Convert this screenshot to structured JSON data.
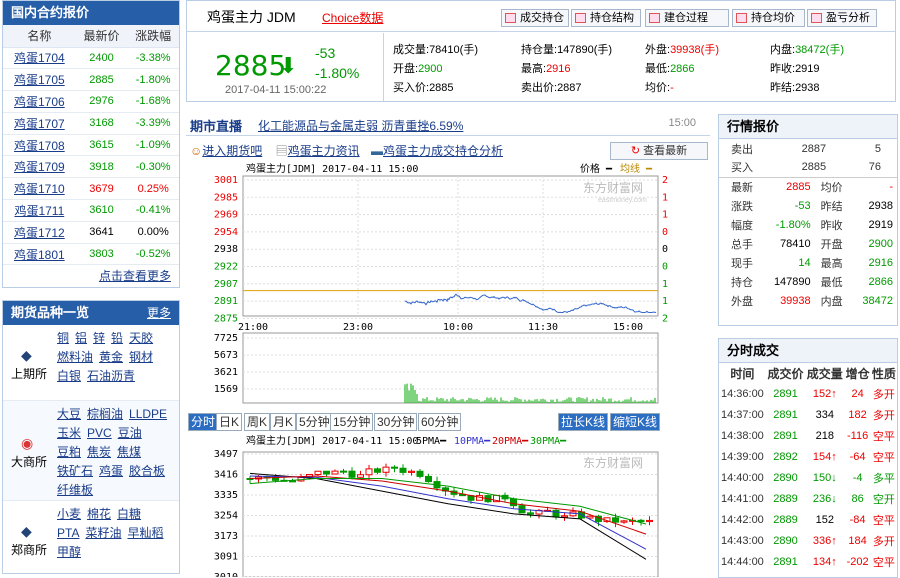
{
  "contracts": {
    "title": "国内合约报价",
    "headers": [
      "名称",
      "最新价",
      "涨跌幅"
    ],
    "rows": [
      [
        "鸡蛋1704",
        "2400",
        "-3.38%",
        "g"
      ],
      [
        "鸡蛋1705",
        "2885",
        "-1.80%",
        "g"
      ],
      [
        "鸡蛋1706",
        "2976",
        "-1.68%",
        "g"
      ],
      [
        "鸡蛋1707",
        "3168",
        "-3.39%",
        "g"
      ],
      [
        "鸡蛋1708",
        "3615",
        "-1.09%",
        "g"
      ],
      [
        "鸡蛋1709",
        "3918",
        "-0.30%",
        "g"
      ],
      [
        "鸡蛋1710",
        "3679",
        "0.25%",
        "r"
      ],
      [
        "鸡蛋1711",
        "3610",
        "-0.41%",
        "g"
      ],
      [
        "鸡蛋1712",
        "3641",
        "0.00%",
        "k"
      ],
      [
        "鸡蛋1801",
        "3803",
        "-0.52%",
        "g"
      ]
    ],
    "more": "点击查看更多"
  },
  "varieties": {
    "title": "期货品种一览",
    "more": "更多",
    "groups": [
      {
        "name": "上期所",
        "items": [
          "铜",
          "铝",
          "锌",
          "铅",
          "天胶",
          "燃料油",
          "黄金",
          "钢材",
          "白银",
          "石油沥青"
        ]
      },
      {
        "name": "大商所",
        "items": [
          "大豆",
          "棕榈油",
          "LLDPE",
          "玉米",
          "PVC",
          "豆油",
          "豆粕",
          "焦炭",
          "焦煤",
          "铁矿石",
          "鸡蛋",
          "胶合板",
          "纤维板"
        ]
      },
      {
        "name": "郑商所",
        "items": [
          "小麦",
          "棉花",
          "白糖",
          "PTA",
          "菜籽油",
          "早籼稻",
          "甲醇"
        ]
      }
    ]
  },
  "header": {
    "name": "鸡蛋主力 JDM",
    "choice": "Choice数据",
    "price": "2885",
    "change": "-53",
    "pct": "-1.80%",
    "time": "2017-04-11 15:00:22",
    "buttons": [
      "成交持仓",
      "持仓结构",
      "建仓过程",
      "持仓均价",
      "盈亏分析"
    ],
    "stats": [
      [
        "成交量:",
        "78410(手)",
        "k"
      ],
      [
        "持仓量:",
        "147890(手)",
        "k"
      ],
      [
        "外盘:",
        "39938(手)",
        "r"
      ],
      [
        "内盘:",
        "38472(手)",
        "g"
      ],
      [
        "开盘:",
        "2900",
        "g"
      ],
      [
        "最高:",
        "2916",
        "r"
      ],
      [
        "最低:",
        "2866",
        "g"
      ],
      [
        "昨收:",
        "2919",
        "k"
      ],
      [
        "买入价:",
        "2885",
        "k"
      ],
      [
        "卖出价:",
        "2887",
        "k"
      ],
      [
        "均价:",
        "-",
        "r"
      ],
      [
        "昨结:",
        "2938",
        "k"
      ]
    ]
  },
  "news": {
    "label": "期市直播",
    "headline": "化工能源品与金属走弱 沥青重挫6.59%",
    "time": "15:00"
  },
  "links": [
    "进入期货吧",
    "鸡蛋主力资讯",
    "鸡蛋主力成交持仓分析"
  ],
  "refresh": "查看最新",
  "intraday": {
    "title": "鸡蛋主力[JDM] 2017-04-11 15:00",
    "legend_price": "价格",
    "legend_avg": "均线",
    "watermark": "东方财富网",
    "watermark_sub": "eastmoney.com",
    "left_ticks": [
      "3001",
      "2985",
      "2969",
      "2954",
      "2938",
      "2922",
      "2907",
      "2891",
      "2875"
    ],
    "right_ticks": [
      "2.14%",
      "1.61%",
      "1.07%",
      "0.54%",
      "0.00%",
      "0.54%",
      "1.07%",
      "1.61%",
      "2.14%"
    ],
    "x_ticks": [
      "21:00",
      "23:00",
      "10:00",
      "11:30",
      "15:00"
    ],
    "vol_ticks": [
      "7725",
      "5673",
      "3621",
      "1569"
    ]
  },
  "chart_data": [
    {
      "type": "line",
      "title": "鸡蛋主力[JDM] 2017-04-11 15:00",
      "x": [
        "21:00",
        "23:00",
        "10:00",
        "11:30",
        "15:00"
      ],
      "ylim": [
        2875,
        3001
      ],
      "series": [
        {
          "name": "价格",
          "values": [
            2895,
            2885,
            2906,
            2893,
            2885
          ]
        },
        {
          "name": "均线",
          "values": [
            2900,
            2900,
            2900,
            2900,
            2900
          ]
        }
      ]
    },
    {
      "type": "bar",
      "title": "",
      "categories": [
        "21:00",
        "23:00",
        "10:00",
        "11:30",
        "15:00"
      ],
      "values": [
        0,
        0,
        7725,
        600,
        1200
      ],
      "ylim": [
        0,
        7725
      ]
    },
    {
      "type": "line",
      "title": "鸡蛋主力[JDM] 2017-04-11 15:00",
      "ylim": [
        3010,
        3497
      ],
      "series": [
        {
          "name": "5PMA",
          "values": [
            3420,
            3400,
            3350,
            3300,
            3260,
            3240,
            3080
          ]
        },
        {
          "name": "10PMA",
          "values": [
            3410,
            3405,
            3370,
            3320,
            3280,
            3260,
            3120
          ]
        },
        {
          "name": "20PMA",
          "values": [
            3400,
            3410,
            3390,
            3350,
            3300,
            3270,
            3180
          ]
        },
        {
          "name": "30PMA",
          "values": [
            3380,
            3400,
            3400,
            3370,
            3320,
            3290,
            3220
          ]
        }
      ]
    }
  ],
  "ktabs": [
    "分时",
    "日K",
    "周K",
    "月K",
    "5分钟",
    "15分钟",
    "30分钟",
    "60分钟"
  ],
  "kbtns": [
    "拉长K线",
    "缩短K线"
  ],
  "kline": {
    "title": "鸡蛋主力[JDM] 2017-04-11 15:00",
    "ma": [
      "5PMA",
      "10PMA",
      "20PMA",
      "30PMA"
    ],
    "ticks": [
      "3497",
      "3416",
      "3335",
      "3254",
      "3173",
      "3091",
      "3010"
    ]
  },
  "quote": {
    "title": "行情报价",
    "book": [
      [
        "卖出",
        "2887",
        "5"
      ],
      [
        "买入",
        "2885",
        "76"
      ]
    ],
    "rows": [
      [
        "最新",
        "2885",
        "r",
        "均价",
        "-",
        "r"
      ],
      [
        "涨跌",
        "-53",
        "g",
        "昨结",
        "2938",
        "k"
      ],
      [
        "幅度",
        "-1.80%",
        "g",
        "昨收",
        "2919",
        "k"
      ],
      [
        "总手",
        "78410",
        "k",
        "开盘",
        "2900",
        "g"
      ],
      [
        "现手",
        "14",
        "g",
        "最高",
        "2916",
        "g"
      ],
      [
        "持仓",
        "147890",
        "k",
        "最低",
        "2866",
        "g"
      ],
      [
        "外盘",
        "39938",
        "r",
        "内盘",
        "38472",
        "g"
      ]
    ]
  },
  "ticks": {
    "title": "分时成交",
    "headers": [
      "时间",
      "成交价",
      "成交量",
      "增仓",
      "性质"
    ],
    "rows": [
      [
        "14:36:00",
        "2891",
        "152",
        "↑",
        "24",
        "多开",
        "r"
      ],
      [
        "14:37:00",
        "2891",
        "334",
        "",
        "182",
        "多开",
        "r"
      ],
      [
        "14:38:00",
        "2891",
        "218",
        "",
        "-116",
        "空平",
        "r"
      ],
      [
        "14:39:00",
        "2892",
        "154",
        "↑",
        "-64",
        "空平",
        "r"
      ],
      [
        "14:40:00",
        "2890",
        "150",
        "↓",
        "-4",
        "多平",
        "g"
      ],
      [
        "14:41:00",
        "2889",
        "236",
        "↓",
        "86",
        "空开",
        "g"
      ],
      [
        "14:42:00",
        "2889",
        "152",
        "",
        "-84",
        "空平",
        "r"
      ],
      [
        "14:43:00",
        "2890",
        "336",
        "↑",
        "184",
        "多开",
        "r"
      ],
      [
        "14:44:00",
        "2891",
        "134",
        "↑",
        "-202",
        "空平",
        "r"
      ]
    ]
  }
}
